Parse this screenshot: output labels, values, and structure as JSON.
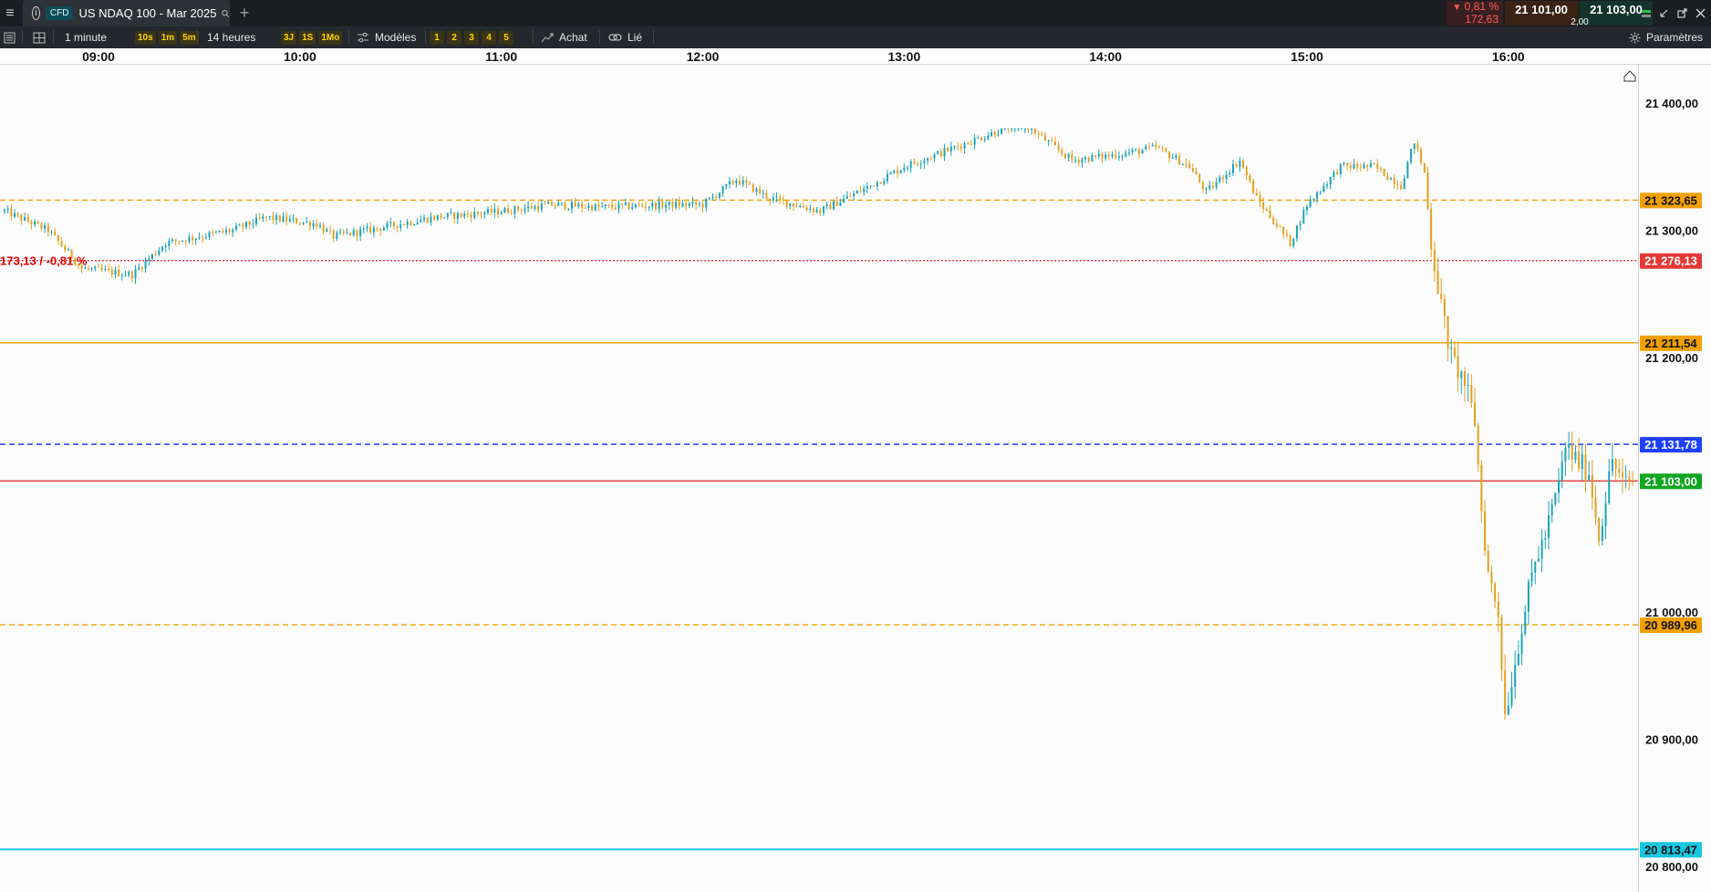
{
  "header": {
    "menu_icon": "hamburger-icon",
    "info_icon": "info-icon",
    "info_glyph": "i",
    "cfd_badge": "CFD",
    "instrument_title": "US NDAQ 100 - Mar 2025",
    "search_icon": "search-icon",
    "add_tab_glyph": "+",
    "change_percent": "0,81 %",
    "change_points": "172,63",
    "change_arrow": "▼",
    "bid_price": "21 101,00",
    "spread": "2,00",
    "ask_price": "21 103,00",
    "window_controls": [
      "signal-icon",
      "minimize-icon",
      "popout-icon",
      "close-icon"
    ]
  },
  "toolbar": {
    "interval_label": "1 minute",
    "quick_intervals": [
      "10s",
      "1m",
      "5m"
    ],
    "range_label": "14 heures",
    "quick_ranges": [
      "3J",
      "1S",
      "1Mo"
    ],
    "templates_label": "Modèles",
    "layout_numbers": [
      "1",
      "2",
      "3",
      "4",
      "5"
    ],
    "order_label": "Achat",
    "link_label": "Lié",
    "settings_label": "Paramètres"
  },
  "colors": {
    "up_candle": "#1aa3b8",
    "down_candle": "#e3a020",
    "orange_line": "#f0a000",
    "red_line": "#e53935",
    "blue_line": "#1e40ff",
    "cyan_line": "#19c6e0",
    "current_price_bg": "#11a620",
    "daily_line_label": "#e00000"
  },
  "chart_data": {
    "type": "candlestick",
    "interval": "1 minute",
    "x_ticks": [
      "09:00",
      "10:00",
      "11:00",
      "12:00",
      "13:00",
      "14:00",
      "15:00",
      "16:00"
    ],
    "x_range": [
      "08:32",
      "16:37"
    ],
    "y_ticks": [
      "21 400,00",
      "21 300,00",
      "21 200,00",
      "21 000,00",
      "20 900,00",
      "20 800,00"
    ],
    "y_tick_values": [
      21400,
      21300,
      21200,
      21000,
      20900,
      20800
    ],
    "ylim": [
      20780,
      21430
    ],
    "close_path": [
      [
        "08:32",
        21315
      ],
      [
        "08:45",
        21300
      ],
      [
        "08:55",
        21270
      ],
      [
        "09:10",
        21265
      ],
      [
        "09:20",
        21290
      ],
      [
        "09:40",
        21300
      ],
      [
        "09:50",
        21310
      ],
      [
        "10:05",
        21305
      ],
      [
        "10:10",
        21295
      ],
      [
        "10:20",
        21300
      ],
      [
        "10:40",
        21310
      ],
      [
        "11:00",
        21315
      ],
      [
        "11:15",
        21320
      ],
      [
        "11:30",
        21318
      ],
      [
        "11:50",
        21320
      ],
      [
        "12:00",
        21320
      ],
      [
        "12:10",
        21340
      ],
      [
        "12:20",
        21325
      ],
      [
        "12:35",
        21315
      ],
      [
        "12:50",
        21335
      ],
      [
        "13:00",
        21350
      ],
      [
        "13:15",
        21365
      ],
      [
        "13:25",
        21375
      ],
      [
        "13:35",
        21385
      ],
      [
        "13:50",
        21355
      ],
      [
        "14:05",
        21360
      ],
      [
        "14:15",
        21365
      ],
      [
        "14:25",
        21350
      ],
      [
        "14:30",
        21330
      ],
      [
        "14:40",
        21355
      ],
      [
        "14:45",
        21325
      ],
      [
        "14:55",
        21290
      ],
      [
        "15:00",
        21320
      ],
      [
        "15:10",
        21350
      ],
      [
        "15:20",
        21350
      ],
      [
        "15:28",
        21335
      ],
      [
        "15:32",
        21370
      ],
      [
        "15:35",
        21345
      ],
      [
        "15:37",
        21290
      ],
      [
        "15:40",
        21240
      ],
      [
        "15:43",
        21200
      ],
      [
        "15:47",
        21180
      ],
      [
        "15:50",
        21150
      ],
      [
        "15:52",
        21080
      ],
      [
        "15:54",
        21030
      ],
      [
        "15:57",
        21000
      ],
      [
        "15:59",
        20920
      ],
      [
        "16:02",
        20960
      ],
      [
        "16:04",
        20990
      ],
      [
        "16:08",
        21040
      ],
      [
        "16:11",
        21060
      ],
      [
        "16:15",
        21100
      ],
      [
        "16:17",
        21130
      ],
      [
        "16:20",
        21120
      ],
      [
        "16:24",
        21110
      ],
      [
        "16:27",
        21060
      ],
      [
        "16:31",
        21120
      ],
      [
        "16:34",
        21100
      ],
      [
        "16:37",
        21103
      ]
    ],
    "high": 21380,
    "low": 20897,
    "levels": [
      {
        "price": 21323.65,
        "label": "21 323,65",
        "style": "dashed",
        "color": "orange"
      },
      {
        "price": 21276.13,
        "label": "21 276,13",
        "style": "dotted",
        "color": "red"
      },
      {
        "price": 21211.54,
        "label": "21 211,54",
        "style": "solid",
        "color": "orange"
      },
      {
        "price": 21131.78,
        "label": "21 131,78",
        "style": "dashed",
        "color": "blue"
      },
      {
        "price": 21103.0,
        "label": "21 103,00",
        "style": "solid",
        "color": "red",
        "current": true
      },
      {
        "price": 20989.96,
        "label": "20 989,96",
        "style": "dashed",
        "color": "orange"
      },
      {
        "price": 20813.47,
        "label": "20 813,47",
        "style": "solid",
        "color": "cyan"
      }
    ],
    "daily_change_label": "173,13 / -0,81 %"
  }
}
